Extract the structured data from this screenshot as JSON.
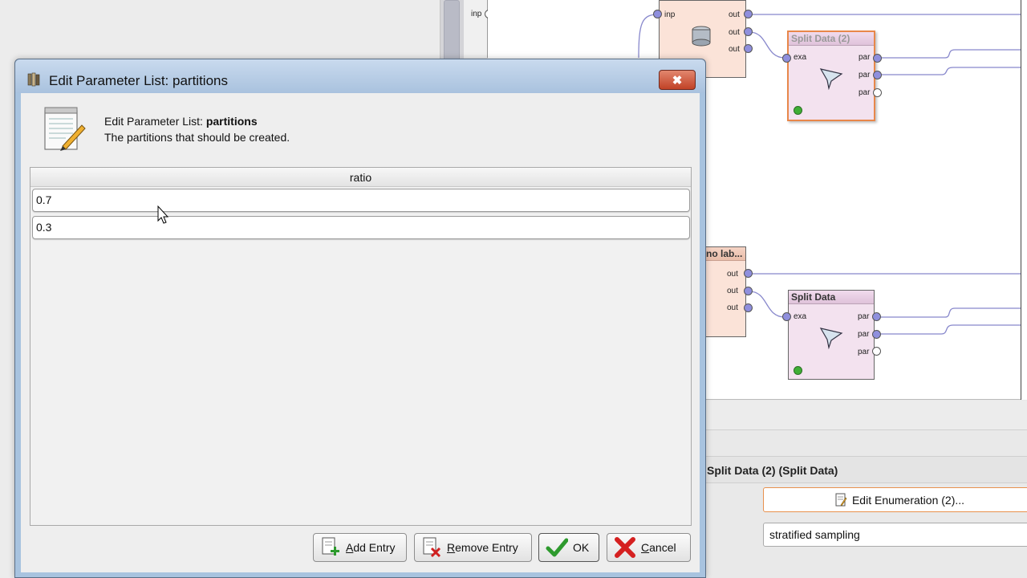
{
  "dialog": {
    "title": "Edit Parameter List: partitions",
    "close_label": "✖",
    "header_prefix": "Edit Parameter List: ",
    "header_param": "partitions",
    "description": "The partitions that should be created.",
    "column_header": "ratio",
    "rows": [
      "0.7",
      "0.3"
    ],
    "buttons": {
      "add_entry": {
        "accel": "A",
        "rest": "dd Entry"
      },
      "remove_entry": {
        "accel": "R",
        "rest": "emove Entry"
      },
      "ok": "OK",
      "cancel": {
        "accel": "C",
        "rest": "ancel"
      }
    }
  },
  "process": {
    "input_strip_label": "inp",
    "top_operator": {
      "ports_in": [
        "inp"
      ],
      "ports_out": [
        "out",
        "out",
        "out"
      ]
    },
    "split_data_2": {
      "title": "Split Data (2)",
      "port_in": "exa",
      "ports_out": [
        "par",
        "par",
        "par"
      ]
    },
    "no_label_operator": {
      "title": "no lab...",
      "ports_out": [
        "out",
        "out",
        "out"
      ]
    },
    "split_data": {
      "title": "Split Data",
      "port_in": "exa",
      "ports_out": [
        "par",
        "par",
        "par"
      ]
    }
  },
  "parameters": {
    "title": "Split Data (2) (Split Data)",
    "edit_enumeration_label": "Edit Enumeration (2)...",
    "sampling_type_value": "stratified sampling"
  },
  "colors": {
    "selection_orange": "#e8874a",
    "port_blue": "#8f8fdd",
    "connection_line": "#8888cc",
    "titlebar": "#b6cce6"
  }
}
